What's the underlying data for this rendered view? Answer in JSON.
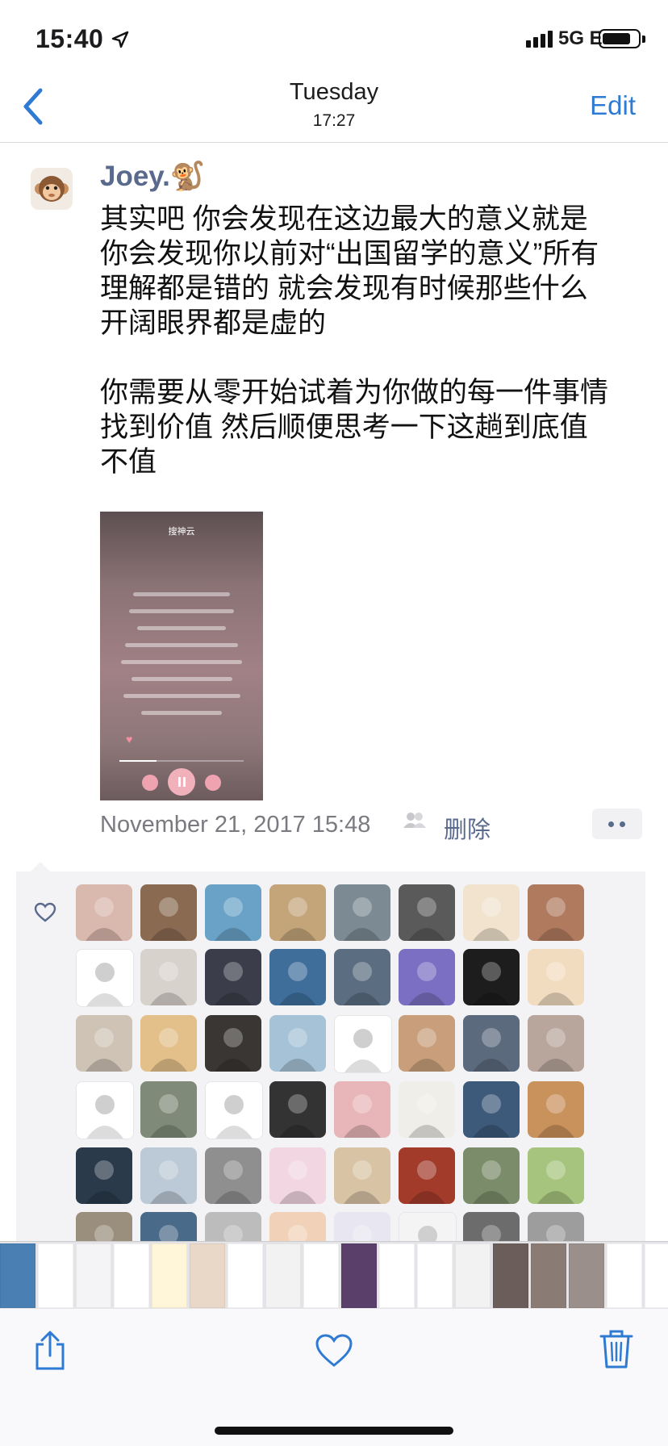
{
  "status_bar": {
    "time": "15:40",
    "network": "5G E"
  },
  "nav": {
    "title": "Tuesday",
    "subtitle": "17:27",
    "edit_label": "Edit"
  },
  "post": {
    "author": "Joey.🐒",
    "text": "其实吧 你会发现在这边最大的意义就是\n你会发现你以前对“出国留学的意义”所有\n理解都是错的 就会发现有时候那些什么\n开阔眼界都是虚的\n\n你需要从零开始试着为你做的每一件事情\n找到价值 然后顺便思考一下这趟到底值\n不值",
    "date": "November 21, 2017 15:48",
    "delete_label": "删除"
  },
  "music_player": {
    "title": "搜神云",
    "progress": 0.3
  },
  "likes": {
    "count": 48,
    "avatars": [
      "#d9b8ad",
      "#8a6b52",
      "#6aa2c7",
      "#c4a57a",
      "#7c8a93",
      "#5a5a5a",
      "#f2e3cf",
      "#b07a5e",
      "#ffffff",
      "#d8d2cc",
      "#3b3d4a",
      "#3f6e9b",
      "#5b6d80",
      "#7a6fc2",
      "#1d1d1d",
      "#f1dcc0",
      "#cfc3b5",
      "#e3c08a",
      "#3a3633",
      "#a5c2d6",
      "#ffffff",
      "#c89f7a",
      "#5c6a7d",
      "#b8a59c",
      "#ffffff",
      "#7f8b78",
      "#ffffff",
      "#333333",
      "#e8b6b9",
      "#f0eee9",
      "#3d5a7a",
      "#c9915b",
      "#2a3a4a",
      "#bcc9d6",
      "#8f8f8f",
      "#f2d6e2",
      "#d8c4a5",
      "#a33b2b",
      "#7b8c6a",
      "#a6c47d",
      "#9a8e7d",
      "#4a6a8a",
      "#bcbcbc",
      "#f1d2b8",
      "#e8e6f0",
      "#f4f4f4",
      "#6c6c6c",
      "#9d9d9d"
    ]
  },
  "thumbnails": [
    "#4a7fb3",
    "#ffffff",
    "#f4f4f6",
    "#ffffff",
    "#fff6da",
    "#e9d8c8",
    "#ffffff",
    "#f2f2f2",
    "#ffffff",
    "#5a3f6a",
    "#ffffff",
    "#ffffff",
    "#f2f2f2",
    "#6b5e5a",
    "#8a7c74",
    "#9a8f8a",
    "#ffffff",
    "#ffffff",
    "#eef2f4",
    "#cfd9c9",
    "#f4f4f4"
  ],
  "colors": {
    "link": "#596a8c",
    "accent": "#2f7ad2"
  },
  "icons": {
    "back": "chevron-left-icon",
    "share": "share-icon",
    "heart": "heart-icon",
    "trash": "trash-icon"
  }
}
